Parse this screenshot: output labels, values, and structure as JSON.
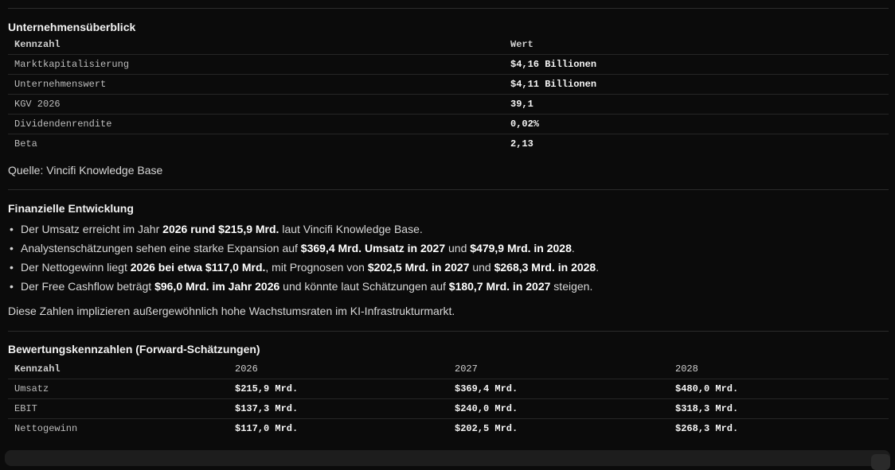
{
  "overview": {
    "title": "Unternehmensüberblick",
    "headers": [
      "Kennzahl",
      "Wert"
    ],
    "rows": [
      {
        "label": "Marktkapitalisierung",
        "value": "$4,16 Billionen"
      },
      {
        "label": "Unternehmenswert",
        "value": "$4,11 Billionen"
      },
      {
        "label": "KGV 2026",
        "value": "39,1"
      },
      {
        "label": "Dividendenrendite",
        "value": "0,02%"
      },
      {
        "label": "Beta",
        "value": "2,13"
      }
    ],
    "source": "Quelle: Vincifi Knowledge Base"
  },
  "development": {
    "title": "Finanzielle Entwicklung",
    "bullets": [
      {
        "p1": "Der Umsatz erreicht im Jahr ",
        "b1": "2026 rund $215,9 Mrd.",
        "p2": " laut Vincifi Knowledge Base.",
        "b2": "",
        "p3": "",
        "b3": "",
        "p4": ""
      },
      {
        "p1": "Analystenschätzungen sehen eine starke Expansion auf ",
        "b1": "$369,4 Mrd. Umsatz in 2027",
        "p2": " und ",
        "b2": "$479,9 Mrd. in 2028",
        "p3": ".",
        "b3": "",
        "p4": ""
      },
      {
        "p1": "Der Nettogewinn liegt ",
        "b1": "2026 bei etwa $117,0 Mrd.",
        "p2": ", mit Prognosen von ",
        "b2": "$202,5 Mrd. in 2027",
        "p3": " und ",
        "b3": "$268,3 Mrd. in 2028",
        "p4": "."
      },
      {
        "p1": "Der Free Cashflow beträgt ",
        "b1": "$96,0 Mrd. im Jahr 2026",
        "p2": " und könnte laut Schätzungen auf ",
        "b2": "$180,7 Mrd. in 2027",
        "p3": " steigen.",
        "b3": "",
        "p4": ""
      }
    ],
    "summary": "Diese Zahlen implizieren außergewöhnlich hohe Wachstumsraten im KI-Infrastrukturmarkt."
  },
  "valuation": {
    "title": "Bewertungskennzahlen (Forward-Schätzungen)",
    "headers": [
      "Kennzahl",
      "2026",
      "2027",
      "2028"
    ],
    "rows": [
      {
        "label": "Umsatz",
        "v2026": "$215,9 Mrd.",
        "v2027": "$369,4 Mrd.",
        "v2028": "$480,0 Mrd."
      },
      {
        "label": "EBIT",
        "v2026": "$137,3 Mrd.",
        "v2027": "$240,0 Mrd.",
        "v2028": "$318,3 Mrd."
      },
      {
        "label": "Nettogewinn",
        "v2026": "$117,0 Mrd.",
        "v2027": "$202,5 Mrd.",
        "v2028": "$268,3 Mrd."
      }
    ]
  }
}
